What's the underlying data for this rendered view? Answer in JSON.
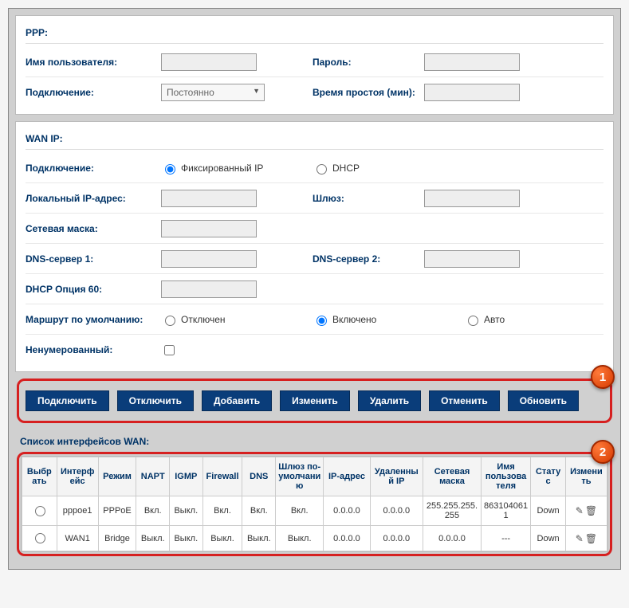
{
  "ppp": {
    "title": "PPP:",
    "username_label": "Имя пользователя:",
    "username_value": "",
    "password_label": "Пароль:",
    "password_value": "",
    "connection_label": "Подключение:",
    "connection_value": "Постоянно",
    "idle_label": "Время простоя (мин):",
    "idle_value": ""
  },
  "wan": {
    "title": "WAN IP:",
    "connection_label": "Подключение:",
    "conn_fixed": "Фиксированный IP",
    "conn_dhcp": "DHCP",
    "local_ip_label": "Локальный IP-адрес:",
    "local_ip_value": "",
    "gateway_label": "Шлюз:",
    "gateway_value": "",
    "netmask_label": "Сетевая маска:",
    "netmask_value": "",
    "dns1_label": "DNS-сервер 1:",
    "dns1_value": "",
    "dns2_label": "DNS-сервер 2:",
    "dns2_value": "",
    "dhcp60_label": "DHCP Опция 60:",
    "dhcp60_value": "",
    "defroute_label": "Маршрут по умолчанию:",
    "defroute_off": "Отключен",
    "defroute_on": "Включено",
    "defroute_auto": "Авто",
    "unnumbered_label": "Ненумерованный:"
  },
  "buttons": {
    "connect": "Подключить",
    "disconnect": "Отключить",
    "add": "Добавить",
    "modify": "Изменить",
    "delete": "Удалить",
    "cancel": "Отменить",
    "refresh": "Обновить"
  },
  "list": {
    "title": "Список интерфейсов WAN:",
    "headers": {
      "select": "Выбрать",
      "iface": "Интерфейс",
      "mode": "Режим",
      "napt": "NAPT",
      "igmp": "IGMP",
      "firewall": "Firewall",
      "dns": "DNS",
      "defgw": "Шлюз по-умолчанию",
      "ip": "IP-адрес",
      "remoteip": "Удаленный IP",
      "netmask": "Сетевая маска",
      "user": "Имя пользователя",
      "status": "Статус",
      "edit": "Изменить"
    },
    "rows": [
      {
        "iface": "pppoe1",
        "mode": "PPPoE",
        "napt": "Вкл.",
        "igmp": "Выкл.",
        "firewall": "Вкл.",
        "dns": "Вкл.",
        "defgw": "Вкл.",
        "ip": "0.0.0.0",
        "remoteip": "0.0.0.0",
        "netmask": "255.255.255.255",
        "user": "8631040611",
        "status": "Down"
      },
      {
        "iface": "WAN1",
        "mode": "Bridge",
        "napt": "Выкл.",
        "igmp": "Выкл.",
        "firewall": "Выкл.",
        "dns": "Выкл.",
        "defgw": "Выкл.",
        "ip": "0.0.0.0",
        "remoteip": "0.0.0.0",
        "netmask": "0.0.0.0",
        "user": "---",
        "status": "Down"
      }
    ]
  },
  "callouts": {
    "one": "1",
    "two": "2"
  }
}
